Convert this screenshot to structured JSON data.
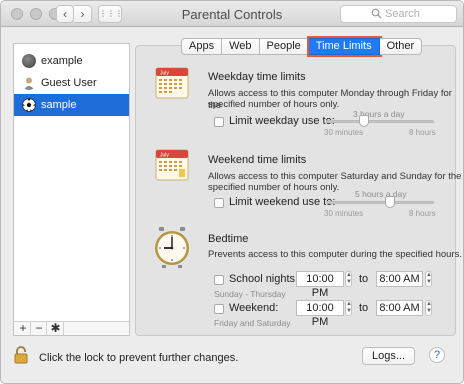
{
  "window": {
    "title": "Parental Controls",
    "search": {
      "placeholder": "Search",
      "value": ""
    },
    "nav": {
      "back": "‹",
      "forward": "›",
      "grid": "⋮⋮⋮"
    }
  },
  "sidebar": {
    "users": [
      {
        "name": "example",
        "selected": false,
        "icon": "gray-user-icon"
      },
      {
        "name": "Guest User",
        "selected": false,
        "icon": "guest-user-icon"
      },
      {
        "name": "sample",
        "selected": true,
        "icon": "soccer-ball-icon"
      }
    ],
    "buttons": {
      "add": "+",
      "remove": "−",
      "settings": "✱"
    }
  },
  "tabs": [
    {
      "label": "Apps",
      "active": false
    },
    {
      "label": "Web",
      "active": false
    },
    {
      "label": "People",
      "active": false
    },
    {
      "label": "Time Limits",
      "active": true
    },
    {
      "label": "Other",
      "active": false
    }
  ],
  "weekday": {
    "title": "Weekday time limits",
    "description_line1": "Allows access to this computer Monday through Friday for the",
    "description_line2": "specified number of hours only.",
    "checkbox_label": "Limit weekday use to:",
    "checked": false,
    "value_label": "3 hours a day",
    "slider_fraction": 0.333,
    "min_label": "30 minutes",
    "max_label": "8 hours",
    "calendar_month": "July",
    "calendar_day": "17"
  },
  "weekend": {
    "title": "Weekend time limits",
    "description_line1": "Allows access to this computer Saturday and Sunday for the",
    "description_line2": "specified number of hours only.",
    "checkbox_label": "Limit weekend use to:",
    "checked": false,
    "value_label": "5 hours a day",
    "slider_fraction": 0.6,
    "min_label": "30 minutes",
    "max_label": "8 hours",
    "calendar_month": "July",
    "calendar_day": "17"
  },
  "bedtime": {
    "title": "Bedtime",
    "description": "Prevents access to this computer during the specified hours.",
    "school": {
      "label": "School nights:",
      "sublabel": "Sunday - Thursday",
      "from": "10:00 PM",
      "to_label": "to",
      "to": "8:00 AM",
      "checked": false
    },
    "weekend": {
      "label": "Weekend:",
      "sublabel": "Friday and Saturday",
      "from": "10:00 PM",
      "to_label": "to",
      "to": "8:00 AM",
      "checked": false
    }
  },
  "footer": {
    "lock_text": "Click the lock to prevent further changes.",
    "logs_button": "Logs...",
    "help_button": "?"
  },
  "colors": {
    "selection_blue": "#1e6dd8",
    "active_tab": "#1e7af5",
    "highlight": "#e05b3a"
  }
}
